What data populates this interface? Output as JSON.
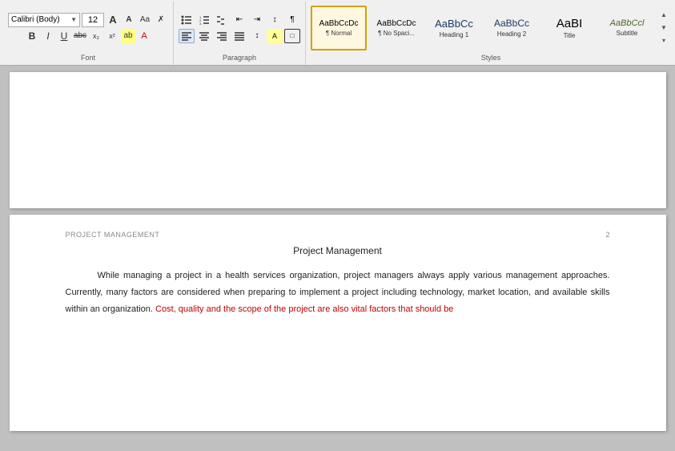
{
  "toolbar": {
    "font_section_label": "Font",
    "paragraph_section_label": "Paragraph",
    "styles_section_label": "Styles",
    "font_name": "Calibri (Body)",
    "font_size": "12",
    "font_grow_label": "A",
    "font_shrink_label": "A",
    "font_case_label": "Aa",
    "font_clear_label": "✗",
    "bold_label": "B",
    "italic_label": "I",
    "underline_label": "U",
    "strikethrough_label": "abc",
    "subscript_label": "x₂",
    "superscript_label": "x²",
    "highlight_label": "ab",
    "color_label": "A",
    "bullets_label": "≡",
    "numbering_label": "≡",
    "multilevel_label": "≡",
    "decrease_indent_label": "⇤",
    "increase_indent_label": "⇥",
    "sort_label": "↕",
    "show_para_label": "¶",
    "align_left_label": "≡",
    "align_center_label": "≡",
    "align_right_label": "≡",
    "justify_label": "≡",
    "line_spacing_label": "↕",
    "shading_label": "▓",
    "border_label": "□",
    "styles": [
      {
        "id": "normal",
        "preview_text": "AaBbCcDc",
        "label": "¶ Normal",
        "active": true,
        "preview_class": "normal"
      },
      {
        "id": "no-spacing",
        "preview_text": "AaBbCcDc",
        "label": "¶ No Spaci...",
        "active": false,
        "preview_class": "nospace"
      },
      {
        "id": "heading1",
        "preview_text": "AaBbCc",
        "label": "Heading 1",
        "active": false,
        "preview_class": "h1"
      },
      {
        "id": "heading2",
        "preview_text": "AaBbCc",
        "label": "Heading 2",
        "active": false,
        "preview_class": "h2"
      },
      {
        "id": "title",
        "preview_text": "AaBI",
        "label": "Title",
        "active": false,
        "preview_class": "title"
      },
      {
        "id": "subtitle",
        "preview_text": "AaBbCcl",
        "label": "Subtitle",
        "active": false,
        "preview_class": "subtitle"
      }
    ]
  },
  "document": {
    "page2": {
      "header_text": "PROJECT MANAGEMENT",
      "page_number": "2",
      "title": "Project Management",
      "paragraphs": [
        {
          "id": "p1",
          "text_normal": "While managing a project in a health services organization, project managers always apply various management approaches. Currently, many factors are considered when preparing to implement a project including technology, market location, and available skills  within an organization. ",
          "text_red": "Cost, quality and the scope of the project are also vital factors that should be"
        }
      ]
    }
  }
}
